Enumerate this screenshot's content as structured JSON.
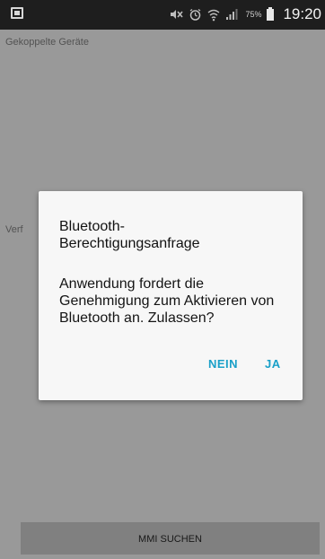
{
  "status_bar": {
    "battery_percent": "75%",
    "time": "19:20",
    "icons": [
      "notification-icon",
      "mute-icon",
      "alarm-icon",
      "wifi-icon",
      "signal-icon",
      "battery-icon"
    ]
  },
  "screen": {
    "paired_devices_label": "Gekoppelte Geräte",
    "available_devices_label": "Verf",
    "footer_button_label": "MMI SUCHEN"
  },
  "dialog": {
    "title": "Bluetooth-Berechtigungsanfrage",
    "title_line1": "Bluetooth-",
    "title_line2": "Berechtigungsanfrage",
    "message": "Anwendung fordert die Genehmigung zum Aktivieren von Bluetooth an. Zulassen?",
    "deny_label": "NEIN",
    "allow_label": "JA"
  },
  "colors": {
    "accent": "#1aa0c8",
    "status_bar": "#1e1e1e",
    "dialog_background": "#f7f7f7",
    "button_background": "#d6d6d6"
  }
}
